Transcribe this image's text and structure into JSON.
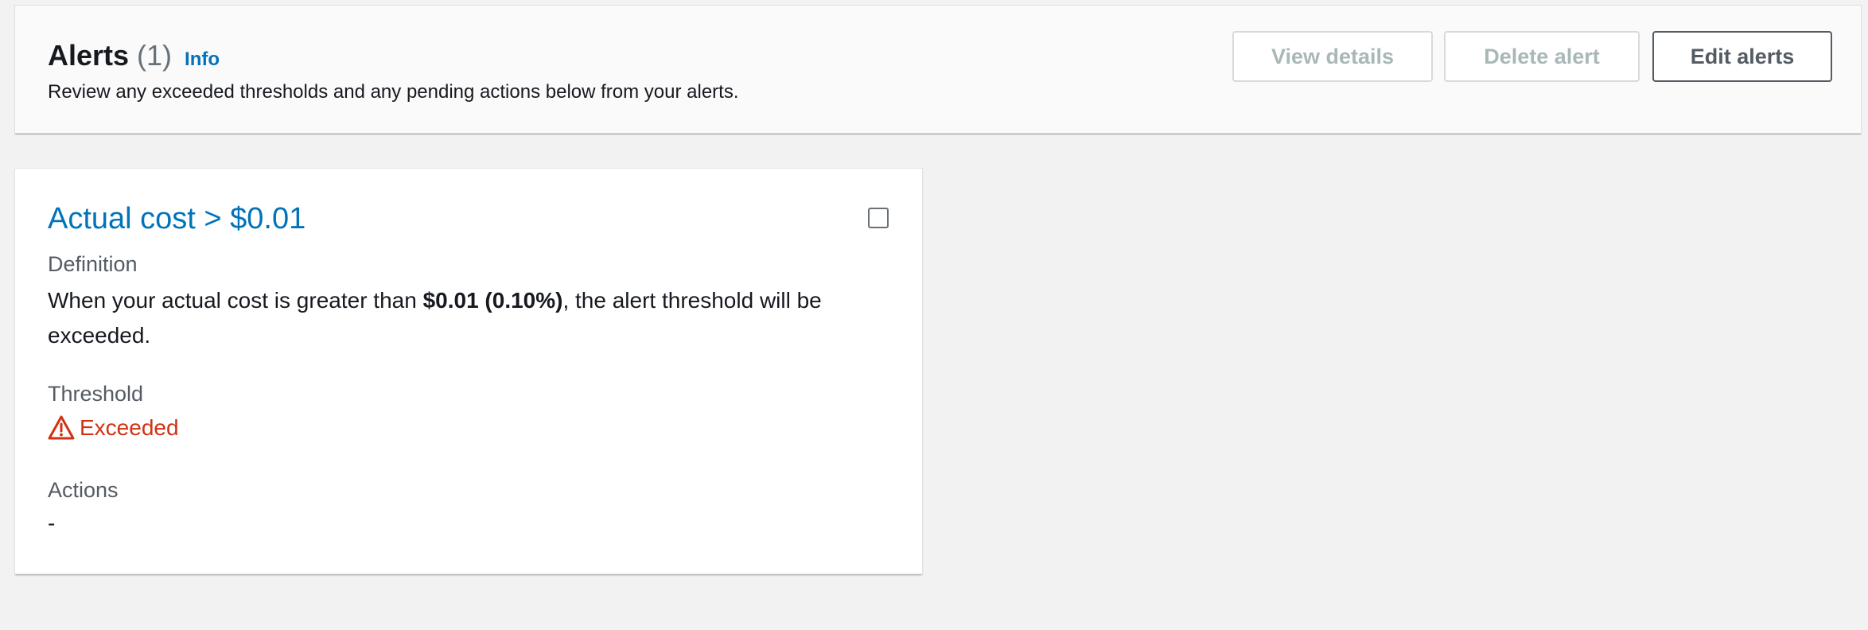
{
  "header": {
    "title": "Alerts",
    "count": "(1)",
    "info_link": "Info",
    "description": "Review any exceeded thresholds and any pending actions below from your alerts."
  },
  "buttons": {
    "view_details": "View details",
    "delete_alert": "Delete alert",
    "edit_alerts": "Edit alerts"
  },
  "alert_card": {
    "title": "Actual cost > $0.01",
    "checkbox_checked": false,
    "definition_label": "Definition",
    "definition_prefix": "When your actual cost is greater than ",
    "definition_amount": "$0.01 (0.10%)",
    "definition_suffix": ", the alert threshold will be exceeded.",
    "threshold_label": "Threshold",
    "threshold_status": "Exceeded",
    "threshold_icon": "warning-icon",
    "actions_label": "Actions",
    "actions_value": "-"
  },
  "colors": {
    "link": "#0073bb",
    "error": "#d13212",
    "page_background": "#f2f2f2"
  }
}
